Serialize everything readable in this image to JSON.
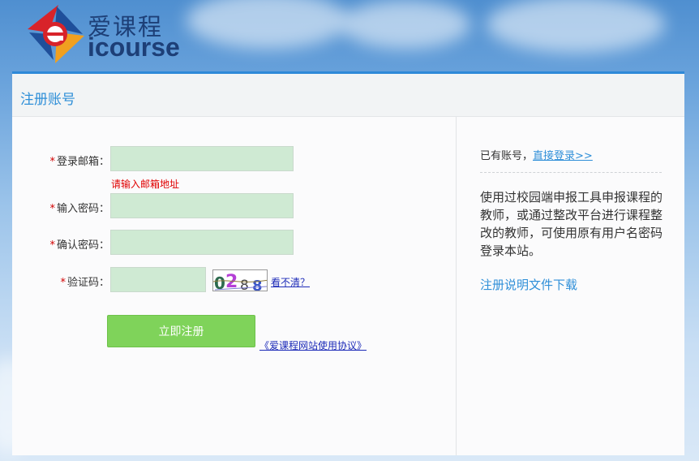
{
  "header": {
    "logo_cn": "爱课程",
    "logo_en": "icourse"
  },
  "panel": {
    "title": "注册账号"
  },
  "form": {
    "required_mark": "*",
    "email_label": "登录邮箱：",
    "email_value": "",
    "email_error": "请输入邮箱地址",
    "password_label": "输入密码：",
    "password_value": "",
    "confirm_label": "确认密码：",
    "confirm_value": "",
    "captcha_label": "验证码：",
    "captcha_value": "",
    "captcha_text": "0288",
    "refresh_link": "看不清？",
    "submit_label": "立即注册",
    "agreement_link": "《爱课程网站使用协议》"
  },
  "sidebar": {
    "have_account_text": "已有账号，",
    "login_link": "直接登录>>",
    "info_text": "使用过校园端申报工具申报课程的教师，或通过整改平台进行课程整改的教师，可使用原有用户名密码登录本站。",
    "download_link": "注册说明文件下载"
  },
  "colors": {
    "accent": "#2f8fd8",
    "input_bg": "#cfead3",
    "button": "#7fd35a",
    "error": "#e00000"
  }
}
